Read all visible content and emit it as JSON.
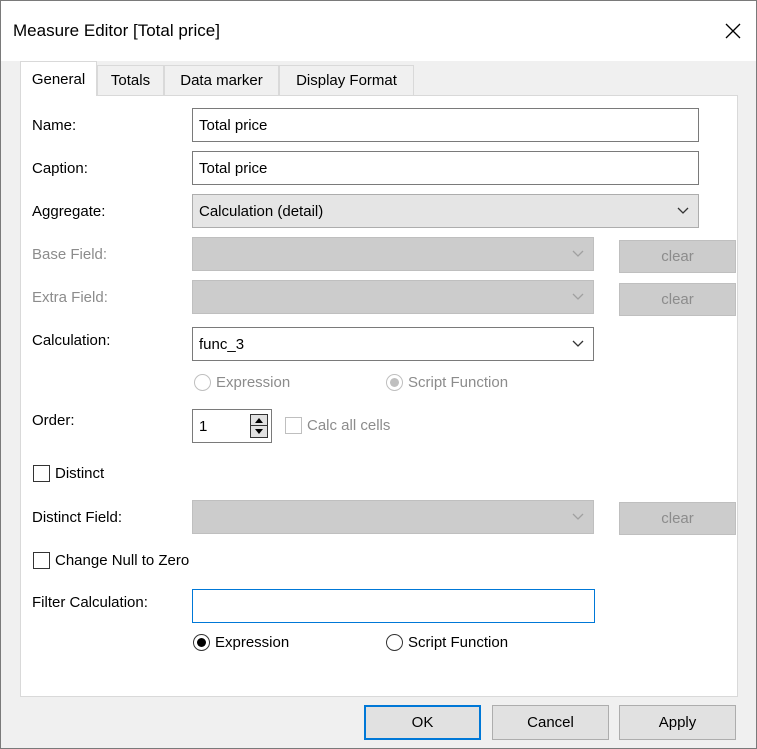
{
  "window": {
    "title": "Measure Editor [Total price]"
  },
  "tabs": [
    {
      "label": "General",
      "active": true
    },
    {
      "label": "Totals",
      "active": false
    },
    {
      "label": "Data marker",
      "active": false
    },
    {
      "label": "Display Format",
      "active": false
    }
  ],
  "general": {
    "name": {
      "label": "Name:",
      "value": "Total price"
    },
    "caption": {
      "label": "Caption:",
      "value": "Total price"
    },
    "aggregate": {
      "label": "Aggregate:",
      "value": "Calculation (detail)"
    },
    "base_field": {
      "label": "Base Field:",
      "value": "",
      "clear_label": "clear",
      "enabled": false
    },
    "extra_field": {
      "label": "Extra Field:",
      "value": "",
      "clear_label": "clear",
      "enabled": false
    },
    "calculation": {
      "label": "Calculation:",
      "value": "func_3",
      "mode_expression": "Expression",
      "mode_script": "Script Function",
      "selected_mode": "Script Function",
      "enabled": false
    },
    "order": {
      "label": "Order:",
      "value": "1",
      "calc_all_cells_label": "Calc all cells",
      "calc_all_cells_checked": false
    },
    "distinct": {
      "label": "Distinct",
      "checked": false
    },
    "distinct_field": {
      "label": "Distinct Field:",
      "value": "",
      "clear_label": "clear",
      "enabled": false
    },
    "change_null": {
      "label": "Change Null to Zero",
      "checked": false
    },
    "filter_calculation": {
      "label": "Filter Calculation:",
      "value": "",
      "mode_expression": "Expression",
      "mode_script": "Script Function",
      "selected_mode": "Expression"
    }
  },
  "footer": {
    "ok_label": "OK",
    "cancel_label": "Cancel",
    "apply_label": "Apply"
  }
}
